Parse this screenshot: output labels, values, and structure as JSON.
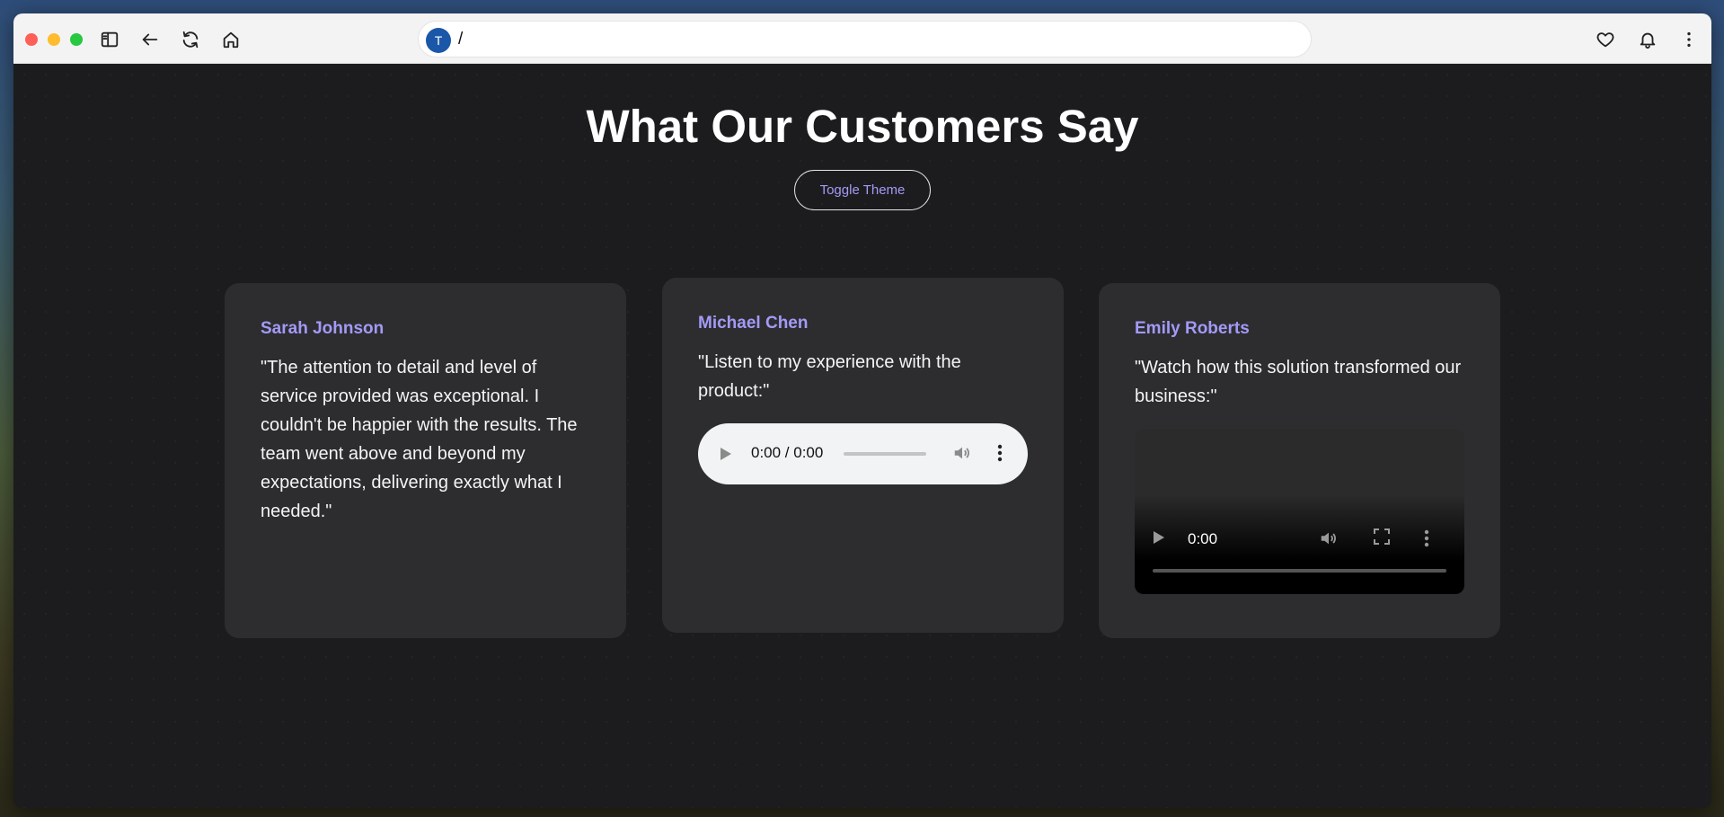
{
  "browser": {
    "avatar_letter": "T",
    "url": "/"
  },
  "page": {
    "title": "What Our Customers Say",
    "toggle_label": "Toggle Theme"
  },
  "testimonials": [
    {
      "name": "Sarah Johnson",
      "quote": "\"The attention to detail and level of service provided was exceptional. I couldn't be happier with the results. The team went above and beyond my expectations, delivering exactly what I needed.\""
    },
    {
      "name": "Michael Chen",
      "quote": "\"Listen to my experience with the product:\"",
      "audio_time": "0:00 / 0:00"
    },
    {
      "name": "Emily Roberts",
      "quote": "\"Watch how this solution transformed our business:\"",
      "video_time": "0:00"
    }
  ],
  "colors": {
    "accent": "#a39af7",
    "card_bg": "#2d2d30",
    "page_bg": "#1c1c1e"
  },
  "icons": [
    "sidebar-icon",
    "back-arrow-icon",
    "reload-icon",
    "home-icon",
    "heart-icon",
    "bell-icon",
    "kebab-menu-icon",
    "play-icon",
    "volume-icon",
    "fullscreen-icon"
  ]
}
